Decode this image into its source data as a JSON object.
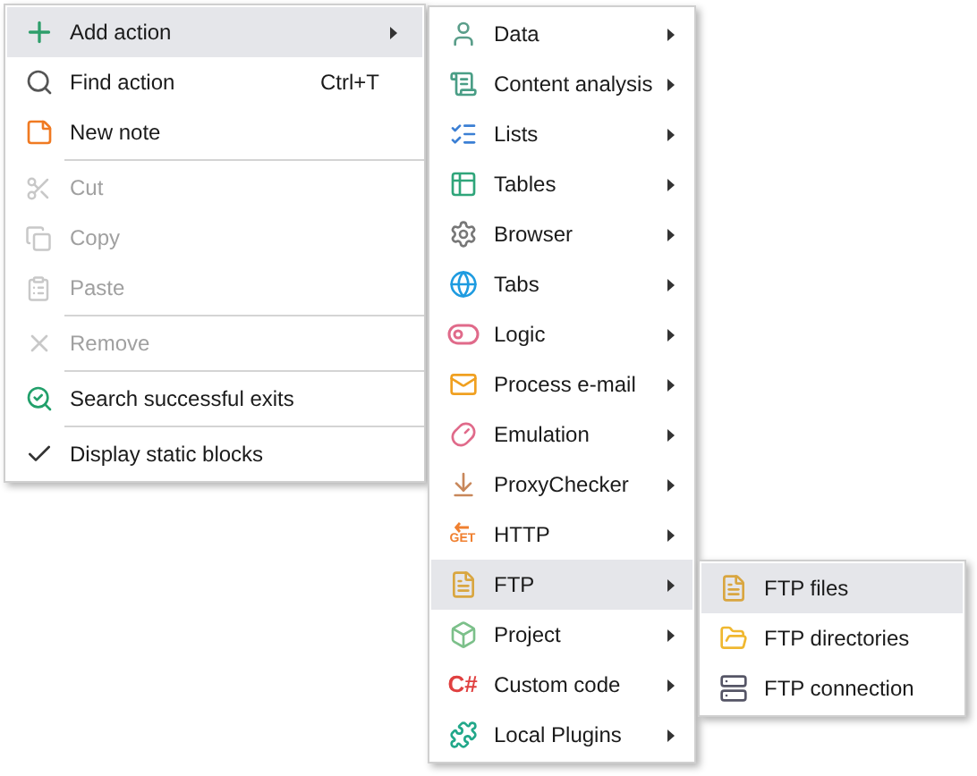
{
  "context_menu": {
    "groups": [
      [
        {
          "label": "Add action",
          "selected": true,
          "has_submenu": true,
          "disabled": false
        },
        {
          "label": "Find action",
          "shortcut": "Ctrl+T",
          "selected": false,
          "disabled": false
        },
        {
          "label": "New note",
          "selected": false,
          "disabled": false
        }
      ],
      [
        {
          "label": "Cut",
          "selected": false,
          "disabled": true
        },
        {
          "label": "Copy",
          "selected": false,
          "disabled": true
        },
        {
          "label": "Paste",
          "selected": false,
          "disabled": true
        }
      ],
      [
        {
          "label": "Remove",
          "selected": false,
          "disabled": true
        }
      ],
      [
        {
          "label": "Search successful exits",
          "selected": false,
          "disabled": false
        }
      ],
      [
        {
          "label": "Display static blocks",
          "selected": false,
          "disabled": false,
          "checked": true
        }
      ]
    ]
  },
  "action_submenu": {
    "items": [
      {
        "label": "Data",
        "selected": false
      },
      {
        "label": "Content analysis",
        "selected": false
      },
      {
        "label": "Lists",
        "selected": false
      },
      {
        "label": "Tables",
        "selected": false
      },
      {
        "label": "Browser",
        "selected": false
      },
      {
        "label": "Tabs",
        "selected": false
      },
      {
        "label": "Logic",
        "selected": false
      },
      {
        "label": "Process e-mail",
        "selected": false
      },
      {
        "label": "Emulation",
        "selected": false
      },
      {
        "label": "ProxyChecker",
        "selected": false
      },
      {
        "label": "HTTP",
        "selected": false,
        "icon_text": "GET"
      },
      {
        "label": "FTP",
        "selected": true
      },
      {
        "label": "Project",
        "selected": false
      },
      {
        "label": "Custom code",
        "selected": false,
        "icon_text": "C#"
      },
      {
        "label": "Local Plugins",
        "selected": false
      }
    ]
  },
  "ftp_submenu": {
    "items": [
      {
        "label": "FTP files",
        "selected": true
      },
      {
        "label": "FTP directories",
        "selected": false
      },
      {
        "label": "FTP connection",
        "selected": false
      }
    ]
  }
}
